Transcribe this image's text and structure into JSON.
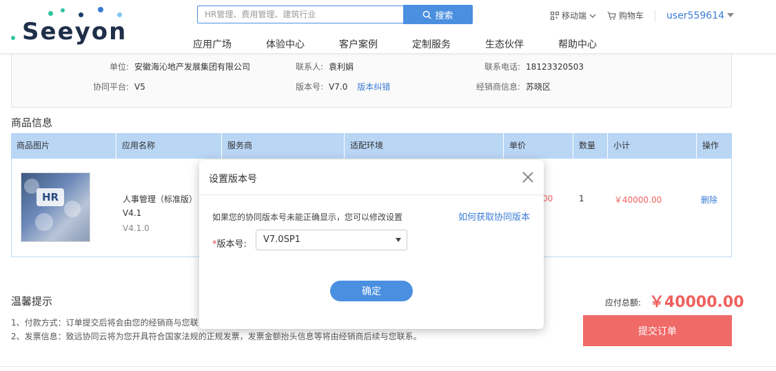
{
  "header": {
    "logo_text": "Seeyon",
    "search_placeholder": "HR管理、费用管理、建筑行业",
    "search_button": "搜索",
    "nav": [
      "应用广场",
      "体验中心",
      "客户案例",
      "定制服务",
      "生态伙伴",
      "帮助中心"
    ],
    "mobile_label": "移动端",
    "cart_label": "购物车",
    "username": "user559614"
  },
  "info": {
    "unit_label": "单位:",
    "unit_value": "安徽海沁地产发展集团有限公司",
    "contact_label": "联系人:",
    "contact_value": "袁利娟",
    "phone_label": "联系电话:",
    "phone_value": "18123320503",
    "platform_label": "协同平台:",
    "platform_value": "V5",
    "version_label": "版本号:",
    "version_value": "V7.0",
    "version_fix_link": "版本纠错",
    "dealer_label": "经销商信息:",
    "dealer_value": "苏晓区"
  },
  "products_section_title": "商品信息",
  "table": {
    "headers": [
      "商品图片",
      "应用名称",
      "服务商",
      "适配环境",
      "单价",
      "数量",
      "小计",
      "操作"
    ],
    "row": {
      "image_badge": "HR",
      "name": "人事管理（标准版）",
      "version1": "V4.1",
      "version2": "V4.1.0",
      "price_partial": "00",
      "quantity": "1",
      "subtotal": "￥40000.00",
      "action": "删除"
    }
  },
  "tips": {
    "title": "温馨提示",
    "line1": "1、付款方式：订单提交后将会由您的经销商与您联系",
    "line2": "2、发票信息：致远协同云将为您开具符合国家法规的正规发票，发票金额抬头信息等将由经销商后续与您联系。"
  },
  "total": {
    "label": "应付总额:",
    "value": "￥40000.00"
  },
  "submit_button": "提交订单",
  "modal": {
    "title": "设置版本号",
    "description": "如果您的协同版本号未能正确显示，您可以修改设置",
    "help_link": "如何获取协同版本",
    "required_mark": "*",
    "field_label": "版本号:",
    "selected_version": "V7.0SP1",
    "confirm_button": "确定"
  },
  "colors": {
    "accent_blue": "#4a8fe0",
    "table_header": "#b9d6f5",
    "price_red": "#f0605e",
    "submit_red": "#f06a68"
  }
}
